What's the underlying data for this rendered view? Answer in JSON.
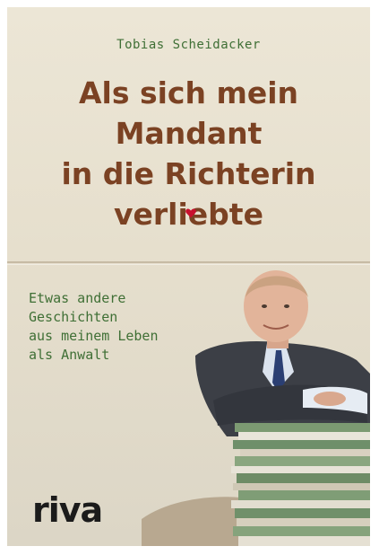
{
  "cover": {
    "author": "Tobias Scheidacker",
    "title_lines": [
      "Als sich mein",
      "Mandant",
      "in die Richterin",
      "verliebte"
    ],
    "subtitle_lines": [
      "Etwas andere",
      "Geschichten",
      "aus meinem Leben",
      "als Anwalt"
    ],
    "publisher": "riva",
    "colors": {
      "title": "#7b4223",
      "author_and_subtitle": "#3f6f35",
      "heart_accent": "#c8102e",
      "background": "#e8e1d1"
    },
    "icons": [
      "heart-icon"
    ]
  }
}
